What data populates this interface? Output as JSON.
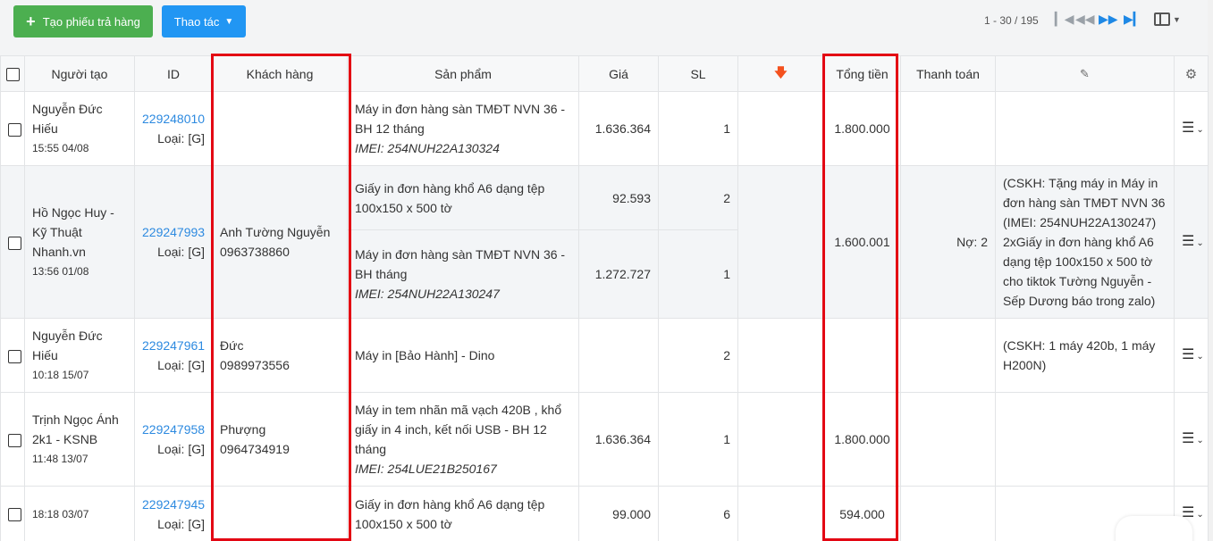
{
  "toolbar": {
    "create_label": "Tạo phiếu trả hàng",
    "actions_label": "Thao tác"
  },
  "pagination": {
    "range_text": "1 - 30 / 195"
  },
  "colors": {
    "primary_green": "#4caf50",
    "primary_blue": "#2196f3",
    "link_blue": "#2d8ae0",
    "total_green": "#4caf50",
    "debt_red": "#e53935",
    "highlight_red": "#e30613"
  },
  "icons": {
    "first": "first-page-icon",
    "prev": "previous-page-icon",
    "next": "next-page-icon",
    "last": "last-page-icon",
    "columns": "column-toggle-icon",
    "sort": "sort-down-arrow-icon",
    "note": "note-icon",
    "settings": "gear-icon",
    "row_menu": "hamburger-menu-icon"
  },
  "columns": {
    "creator": "Người tạo",
    "id": "ID",
    "customer": "Khách hàng",
    "product": "Sản phẩm",
    "price": "Giá",
    "qty": "SL",
    "total": "Tổng tiền",
    "payment": "Thanh toán"
  },
  "rows": [
    {
      "creator": "Nguyễn Đức Hiếu",
      "time": "15:55 04/08",
      "id": "229248010",
      "type": "Loại: [G]",
      "customer_name": "",
      "customer_phone": "",
      "products": [
        {
          "name": "Máy in đơn hàng sàn TMĐT NVN 36 - BH 12 tháng",
          "imei": "IMEI: 254NUH22A130324",
          "price": "1.636.364",
          "qty": "1"
        }
      ],
      "total": "1.800.000",
      "payment": "",
      "note": ""
    },
    {
      "creator": "Hồ Ngọc Huy - Kỹ Thuật Nhanh.vn",
      "time": "13:56 01/08",
      "id": "229247993",
      "type": "Loại: [G]",
      "customer_name": "Anh Tường Nguyễn",
      "customer_phone": "0963738860",
      "products": [
        {
          "name": "Giấy in đơn hàng khổ A6 dạng tệp 100x150 x 500 tờ",
          "imei": "",
          "price": "92.593",
          "qty": "2"
        },
        {
          "name": "Máy in đơn hàng sàn TMĐT NVN 36 - BH tháng",
          "imei": "IMEI: 254NUH22A130247",
          "price": "1.272.727",
          "qty": "1"
        }
      ],
      "total": "1.600.001",
      "payment": "Nợ: 2",
      "note": "(CSKH: Tặng máy in Máy in đơn hàng sàn TMĐT NVN 36 (IMEI: 254NUH22A130247) 2xGiấy in đơn hàng khổ A6 dạng tệp 100x150 x 500 tờ cho tiktok Tường Nguyễn - Sếp Dương báo trong zalo)"
    },
    {
      "creator": "Nguyễn Đức Hiếu",
      "time": "10:18 15/07",
      "id": "229247961",
      "type": "Loại: [G]",
      "customer_name": "Đức",
      "customer_phone": "0989973556",
      "products": [
        {
          "name": "Máy in [Bảo Hành] - Dino",
          "imei": "",
          "price": "",
          "qty": "2"
        }
      ],
      "total": "",
      "payment": "",
      "note": "(CSKH: 1 máy 420b, 1 máy H200N)"
    },
    {
      "creator": "Trịnh Ngọc Ánh 2k1 - KSNB",
      "time": "11:48 13/07",
      "id": "229247958",
      "type": "Loại: [G]",
      "customer_name": "Phượng",
      "customer_phone": "0964734919",
      "products": [
        {
          "name": "Máy in tem nhãn mã vạch 420B , khổ giấy in 4 inch, kết nối USB - BH 12 tháng",
          "imei": "IMEI: 254LUE21B250167",
          "price": "1.636.364",
          "qty": "1"
        }
      ],
      "total": "1.800.000",
      "payment": "",
      "note": ""
    },
    {
      "creator": "",
      "time": "18:18 03/07",
      "id": "229247945",
      "type": "Loại: [G]",
      "customer_name": "",
      "customer_phone": "",
      "products": [
        {
          "name": "Giấy in đơn hàng khổ A6 dạng tệp 100x150 x 500 tờ",
          "imei": "",
          "price": "99.000",
          "qty": "6"
        }
      ],
      "total": "594.000",
      "payment": "",
      "note": ""
    }
  ]
}
